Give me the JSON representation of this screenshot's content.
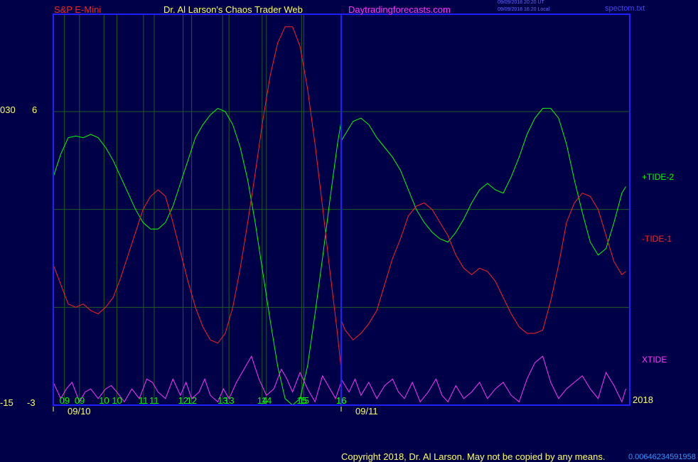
{
  "header": {
    "instrument": "S&P E-Mini",
    "title": "Dr. Al Larson's Chaos Trader Web",
    "site": "Daytradingforecasts.com",
    "stamp_line1": "09/09/2018 20:20 UT",
    "stamp_line2": "09/09/2018 16:20 Local",
    "file": "spectom.txt"
  },
  "axes": {
    "left_outer_top": "030",
    "left_inner_top": "6",
    "left_outer_bottom": "-15",
    "left_inner_bottom": "-3"
  },
  "year_label": "2018",
  "footer": {
    "copyright": "Copyright 2018, Dr. Al Larson. May not be copied by any means.",
    "counter": "0.00646234591958"
  },
  "colors": {
    "background": "#000048",
    "frame": "#2020ff",
    "grid": "#1f5c1f",
    "tide2": "#00ff00",
    "tide1": "#ff2020",
    "xtide": "#ff33ff",
    "tick_text": "#00ff00",
    "date_text": "#ffff66"
  },
  "chart_data": {
    "type": "line",
    "x_unit": "hour",
    "ylim": [
      -3,
      6
    ],
    "hour_ticks": [
      {
        "hour": 9,
        "label": "09"
      },
      {
        "hour": 10,
        "label": "10"
      },
      {
        "hour": 11,
        "label": "11"
      },
      {
        "hour": 12,
        "label": "12"
      },
      {
        "hour": 13,
        "label": "13"
      },
      {
        "hour": 14,
        "label": "14"
      },
      {
        "hour": 15,
        "label": "15"
      },
      {
        "hour": 16,
        "label": "16"
      },
      {
        "hour": 33,
        "label": "09"
      },
      {
        "hour": 34,
        "label": "10"
      },
      {
        "hour": 35,
        "label": "11"
      },
      {
        "hour": 36,
        "label": "12"
      },
      {
        "hour": 37,
        "label": "13"
      },
      {
        "hour": 38,
        "label": "14"
      },
      {
        "hour": 39,
        "label": "15"
      },
      {
        "hour": 40,
        "label": "16"
      }
    ],
    "date_labels": [
      {
        "hour": 8.5,
        "label": "09/10"
      },
      {
        "hour": 32.5,
        "label": "09/11"
      }
    ],
    "session_break_hour": 16.0,
    "series": [
      {
        "name": "+TIDE-2",
        "color": "#00ff00",
        "points": [
          [
            8.3,
            4.0
          ],
          [
            8.5,
            4.7
          ],
          [
            8.7,
            5.2
          ],
          [
            8.9,
            5.25
          ],
          [
            9.1,
            5.2
          ],
          [
            9.3,
            5.3
          ],
          [
            9.5,
            5.2
          ],
          [
            9.7,
            4.9
          ],
          [
            9.9,
            4.5
          ],
          [
            10.1,
            4.0
          ],
          [
            10.3,
            3.5
          ],
          [
            10.5,
            3.0
          ],
          [
            10.7,
            2.6
          ],
          [
            10.9,
            2.4
          ],
          [
            11.1,
            2.4
          ],
          [
            11.3,
            2.6
          ],
          [
            11.5,
            3.1
          ],
          [
            11.7,
            3.8
          ],
          [
            11.9,
            4.5
          ],
          [
            12.1,
            5.2
          ],
          [
            12.3,
            5.6
          ],
          [
            12.5,
            5.9
          ],
          [
            12.7,
            6.1
          ],
          [
            12.9,
            6.0
          ],
          [
            13.1,
            5.6
          ],
          [
            13.3,
            4.9
          ],
          [
            13.5,
            3.9
          ],
          [
            13.7,
            2.6
          ],
          [
            13.9,
            1.1
          ],
          [
            14.1,
            -0.4
          ],
          [
            14.3,
            -1.8
          ],
          [
            14.5,
            -2.8
          ],
          [
            14.7,
            -3.0
          ],
          [
            14.9,
            -2.8
          ],
          [
            15.1,
            -1.8
          ],
          [
            15.3,
            -0.2
          ],
          [
            15.5,
            1.5
          ],
          [
            15.7,
            3.3
          ],
          [
            15.9,
            5.0
          ],
          [
            16.0,
            5.7
          ],
          [
            16.0,
            5.1
          ],
          [
            16.1,
            5.3
          ],
          [
            16.3,
            5.7
          ],
          [
            16.5,
            5.8
          ],
          [
            16.7,
            5.6
          ],
          [
            16.9,
            5.2
          ],
          [
            17.1,
            4.9
          ],
          [
            17.3,
            4.6
          ],
          [
            17.5,
            4.2
          ],
          [
            17.7,
            3.6
          ],
          [
            17.9,
            3.0
          ],
          [
            18.1,
            2.6
          ],
          [
            18.3,
            2.3
          ],
          [
            18.5,
            2.1
          ],
          [
            18.7,
            2.0
          ],
          [
            18.9,
            2.3
          ],
          [
            19.1,
            2.7
          ],
          [
            19.3,
            3.2
          ],
          [
            19.5,
            3.6
          ],
          [
            19.7,
            3.8
          ],
          [
            19.9,
            3.6
          ],
          [
            20.1,
            3.5
          ],
          [
            20.3,
            4.0
          ],
          [
            20.5,
            4.6
          ],
          [
            20.7,
            5.3
          ],
          [
            20.9,
            5.8
          ],
          [
            21.1,
            6.1
          ],
          [
            21.3,
            6.1
          ],
          [
            21.5,
            5.8
          ],
          [
            21.7,
            5.0
          ],
          [
            21.9,
            3.9
          ],
          [
            22.1,
            2.9
          ],
          [
            22.3,
            2.0
          ],
          [
            22.5,
            1.6
          ],
          [
            22.7,
            1.8
          ],
          [
            22.9,
            2.6
          ],
          [
            23.1,
            3.5
          ],
          [
            23.2,
            3.7
          ]
        ]
      },
      {
        "name": "-TIDE-1",
        "color": "#ff2020",
        "points": [
          [
            8.3,
            1.3
          ],
          [
            8.5,
            0.7
          ],
          [
            8.7,
            0.1
          ],
          [
            8.9,
            0.0
          ],
          [
            9.1,
            0.1
          ],
          [
            9.3,
            -0.1
          ],
          [
            9.5,
            -0.2
          ],
          [
            9.7,
            0.0
          ],
          [
            9.9,
            0.3
          ],
          [
            10.1,
            0.9
          ],
          [
            10.3,
            1.6
          ],
          [
            10.5,
            2.3
          ],
          [
            10.7,
            3.0
          ],
          [
            10.9,
            3.4
          ],
          [
            11.1,
            3.6
          ],
          [
            11.3,
            3.4
          ],
          [
            11.5,
            2.6
          ],
          [
            11.7,
            1.7
          ],
          [
            11.9,
            0.8
          ],
          [
            12.1,
            0.0
          ],
          [
            12.3,
            -0.6
          ],
          [
            12.5,
            -1.0
          ],
          [
            12.7,
            -1.1
          ],
          [
            12.9,
            -0.8
          ],
          [
            13.1,
            0.0
          ],
          [
            13.3,
            1.2
          ],
          [
            13.5,
            2.6
          ],
          [
            13.7,
            4.1
          ],
          [
            13.9,
            5.7
          ],
          [
            14.1,
            7.1
          ],
          [
            14.3,
            8.1
          ],
          [
            14.5,
            8.6
          ],
          [
            14.7,
            8.6
          ],
          [
            14.9,
            8.0
          ],
          [
            15.1,
            6.7
          ],
          [
            15.3,
            5.0
          ],
          [
            15.5,
            3.1
          ],
          [
            15.7,
            1.1
          ],
          [
            15.9,
            -0.8
          ],
          [
            16.0,
            -1.9
          ],
          [
            16.0,
            -0.4
          ],
          [
            16.1,
            -0.7
          ],
          [
            16.3,
            -1.0
          ],
          [
            16.5,
            -0.8
          ],
          [
            16.7,
            -0.5
          ],
          [
            16.9,
            -0.1
          ],
          [
            17.1,
            0.7
          ],
          [
            17.3,
            1.5
          ],
          [
            17.5,
            2.1
          ],
          [
            17.7,
            2.8
          ],
          [
            17.9,
            3.1
          ],
          [
            18.1,
            3.2
          ],
          [
            18.3,
            3.0
          ],
          [
            18.5,
            2.6
          ],
          [
            18.7,
            2.2
          ],
          [
            18.9,
            1.6
          ],
          [
            19.1,
            1.2
          ],
          [
            19.3,
            1.0
          ],
          [
            19.5,
            1.2
          ],
          [
            19.7,
            1.1
          ],
          [
            19.9,
            0.8
          ],
          [
            20.1,
            0.3
          ],
          [
            20.3,
            -0.2
          ],
          [
            20.5,
            -0.6
          ],
          [
            20.7,
            -0.8
          ],
          [
            20.9,
            -0.8
          ],
          [
            21.1,
            -0.7
          ],
          [
            21.3,
            0.2
          ],
          [
            21.5,
            1.3
          ],
          [
            21.7,
            2.6
          ],
          [
            21.9,
            3.2
          ],
          [
            22.1,
            3.5
          ],
          [
            22.3,
            3.4
          ],
          [
            22.5,
            3.0
          ],
          [
            22.7,
            2.2
          ],
          [
            22.9,
            1.4
          ],
          [
            23.1,
            1.0
          ],
          [
            23.2,
            1.1
          ]
        ]
      },
      {
        "name": "XTIDE",
        "color": "#ff33ff",
        "points": [
          [
            8.3,
            -2.3
          ],
          [
            8.5,
            -2.8
          ],
          [
            8.65,
            -2.5
          ],
          [
            8.8,
            -2.3
          ],
          [
            9.0,
            -2.9
          ],
          [
            9.15,
            -2.6
          ],
          [
            9.3,
            -2.5
          ],
          [
            9.5,
            -2.8
          ],
          [
            9.7,
            -2.5
          ],
          [
            9.85,
            -2.4
          ],
          [
            10.0,
            -2.6
          ],
          [
            10.2,
            -2.9
          ],
          [
            10.4,
            -2.5
          ],
          [
            10.6,
            -2.8
          ],
          [
            10.8,
            -2.2
          ],
          [
            10.95,
            -2.3
          ],
          [
            11.1,
            -2.6
          ],
          [
            11.3,
            -2.8
          ],
          [
            11.5,
            -2.2
          ],
          [
            11.7,
            -2.7
          ],
          [
            11.85,
            -2.3
          ],
          [
            12.0,
            -2.8
          ],
          [
            12.2,
            -2.6
          ],
          [
            12.35,
            -2.2
          ],
          [
            12.5,
            -2.7
          ],
          [
            12.7,
            -2.9
          ],
          [
            12.85,
            -2.5
          ],
          [
            13.0,
            -2.8
          ],
          [
            13.2,
            -2.3
          ],
          [
            13.4,
            -1.9
          ],
          [
            13.6,
            -1.5
          ],
          [
            13.8,
            -2.2
          ],
          [
            14.0,
            -2.7
          ],
          [
            14.2,
            -2.5
          ],
          [
            14.4,
            -1.9
          ],
          [
            14.55,
            -2.2
          ],
          [
            14.7,
            -2.6
          ],
          [
            14.9,
            -2.0
          ],
          [
            15.1,
            -2.5
          ],
          [
            15.3,
            -2.9
          ],
          [
            15.5,
            -2.1
          ],
          [
            15.7,
            -2.5
          ],
          [
            15.85,
            -2.8
          ],
          [
            16.0,
            -2.3
          ],
          [
            16.0,
            -2.2
          ],
          [
            16.2,
            -2.6
          ],
          [
            16.35,
            -2.2
          ],
          [
            16.5,
            -2.7
          ],
          [
            16.7,
            -2.3
          ],
          [
            16.9,
            -2.8
          ],
          [
            17.1,
            -2.4
          ],
          [
            17.3,
            -2.2
          ],
          [
            17.45,
            -2.6
          ],
          [
            17.6,
            -2.8
          ],
          [
            17.8,
            -2.3
          ],
          [
            18.0,
            -2.9
          ],
          [
            18.2,
            -2.6
          ],
          [
            18.4,
            -2.2
          ],
          [
            18.55,
            -2.7
          ],
          [
            18.7,
            -2.9
          ],
          [
            18.9,
            -2.4
          ],
          [
            19.1,
            -2.8
          ],
          [
            19.3,
            -2.6
          ],
          [
            19.5,
            -2.3
          ],
          [
            19.7,
            -2.8
          ],
          [
            19.9,
            -2.5
          ],
          [
            20.1,
            -2.3
          ],
          [
            20.3,
            -2.7
          ],
          [
            20.5,
            -2.9
          ],
          [
            20.7,
            -2.2
          ],
          [
            20.9,
            -1.7
          ],
          [
            21.1,
            -1.5
          ],
          [
            21.3,
            -2.3
          ],
          [
            21.5,
            -2.8
          ],
          [
            21.7,
            -2.5
          ],
          [
            21.9,
            -2.3
          ],
          [
            22.1,
            -2.1
          ],
          [
            22.3,
            -2.5
          ],
          [
            22.5,
            -2.8
          ],
          [
            22.7,
            -2.0
          ],
          [
            22.9,
            -2.4
          ],
          [
            23.1,
            -2.9
          ],
          [
            23.2,
            -2.5
          ]
        ]
      }
    ]
  }
}
